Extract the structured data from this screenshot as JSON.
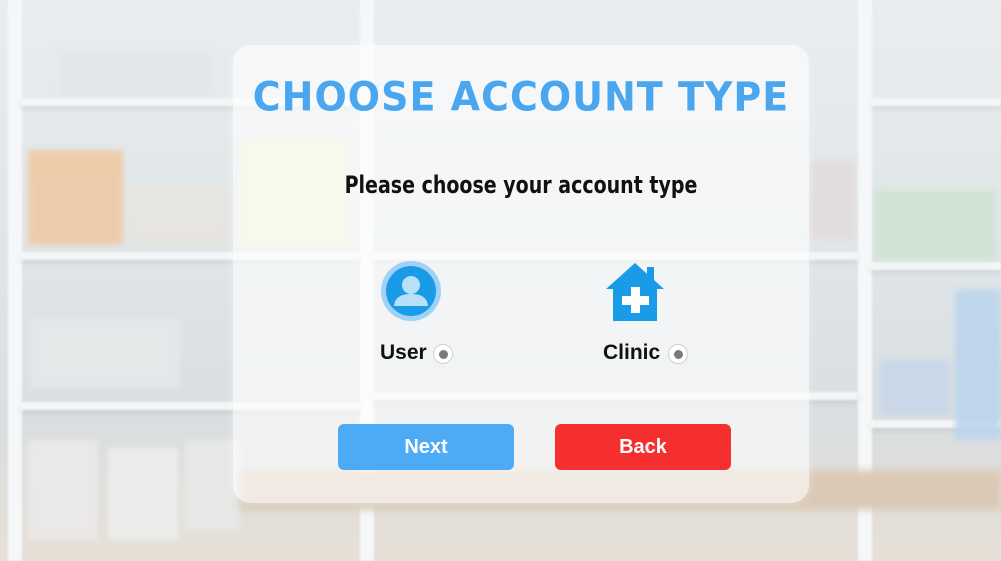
{
  "screen": {
    "title": "CHOOSE ACCOUNT TYPE",
    "subtitle": "Please choose your account type"
  },
  "options": [
    {
      "label": "User",
      "icon": "user-circle-icon",
      "selected": false
    },
    {
      "label": "Clinic",
      "icon": "clinic-house-icon",
      "selected": false
    }
  ],
  "buttons": {
    "next_label": "Next",
    "back_label": "Back"
  },
  "colors": {
    "title": "#4aa6ee",
    "next_button": "#4daaf5",
    "back_button": "#f52f2f",
    "icon_blue": "#1a9be8"
  }
}
